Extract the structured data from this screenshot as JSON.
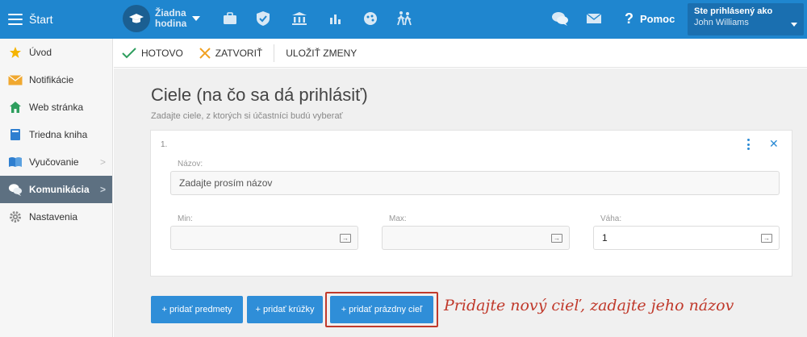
{
  "colors": {
    "topbar": "#1f86cf",
    "primary_button": "#2f8ed8",
    "sidebar_active": "#5d7081",
    "annotation": "#c0392b"
  },
  "header": {
    "start_label": "Štart",
    "school_label_line1": "Žiadna",
    "school_label_line2": "hodina",
    "help_label": "Pomoc",
    "user_title": "Ste prihlásený ako",
    "user_name": "John Williams",
    "nav_icons": [
      "briefcase-icon",
      "shield-icon",
      "building-icon",
      "chart-icon",
      "palette-icon",
      "people-walking-icon"
    ],
    "right_icons": [
      "chat-icon",
      "mail-icon"
    ]
  },
  "sidebar": {
    "items": [
      {
        "label": "Úvod",
        "icon": "star-icon"
      },
      {
        "label": "Notifikácie",
        "icon": "envelope-icon"
      },
      {
        "label": "Web stránka",
        "icon": "home-icon"
      },
      {
        "label": "Triedna kniha",
        "icon": "book-icon"
      },
      {
        "label": "Vyučovanie",
        "icon": "open-book-icon"
      },
      {
        "label": "Komunikácia",
        "icon": "chat-bubbles-icon",
        "active": true
      },
      {
        "label": "Nastavenia",
        "icon": "gear-icon"
      }
    ]
  },
  "toolbar": {
    "done_label": "HOTOVO",
    "close_label": "ZATVORIŤ",
    "save_label": "ULOŽIŤ ZMENY"
  },
  "main": {
    "title": "Ciele (na čo sa dá prihlásiť)",
    "subtitle": "Zadajte ciele, z ktorých si účastníci budú vyberať",
    "card": {
      "number": "1.",
      "name_label": "Názov:",
      "name_placeholder": "Zadajte prosím názov",
      "min_label": "Min:",
      "min_value": "",
      "max_label": "Max:",
      "max_value": "",
      "weight_label": "Váha:",
      "weight_value": "1"
    },
    "buttons": {
      "add_subjects": "+ pridať predmety",
      "add_clubs": "+ pridať krúžky",
      "add_empty_goal": "+ pridať prázdny cieľ"
    },
    "annotation": "Pridajte nový cieľ, zadajte jeho názov"
  }
}
